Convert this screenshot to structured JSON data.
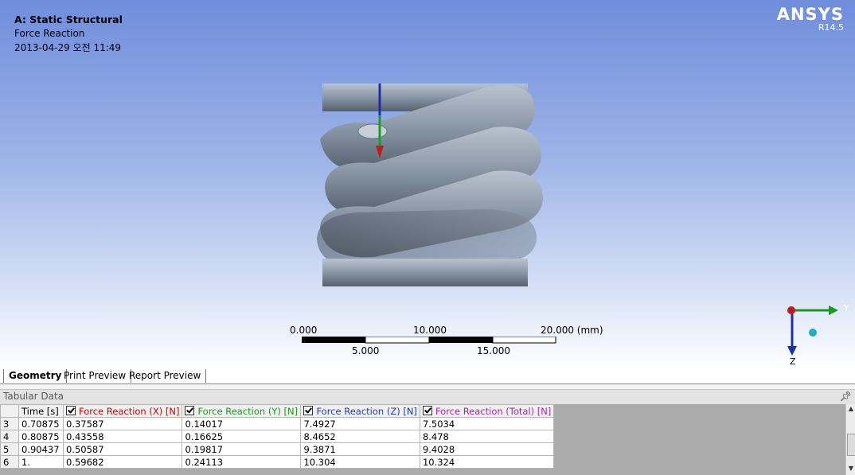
{
  "viewport": {
    "title": "A: Static Structural",
    "subtitle": "Force Reaction",
    "timestamp": "2013-04-29 오전 11:49",
    "logo": {
      "brand": "ANSYS",
      "version": "R14.5"
    },
    "scale": {
      "top_labels": [
        "0.000",
        "10.000",
        "20.000 (mm)"
      ],
      "bottom_labels": [
        "5.000",
        "15.000"
      ]
    },
    "triad": {
      "y_label": "Y",
      "z_label": "Z"
    }
  },
  "tabs": [
    {
      "label": "Geometry",
      "active": true
    },
    {
      "label": "Print Preview",
      "active": false
    },
    {
      "label": "Report Preview",
      "active": false
    }
  ],
  "tabular": {
    "title": "Tabular Data",
    "pin_icon": "pin-icon",
    "columns": [
      {
        "label": "Time [s]",
        "checkbox": false,
        "color": "#000000"
      },
      {
        "label": "Force Reaction (X) [N]",
        "checkbox": true,
        "color": "#cc0000"
      },
      {
        "label": "Force Reaction (Y) [N]",
        "checkbox": true,
        "color": "#1a9a1a"
      },
      {
        "label": "Force Reaction (Z) [N]",
        "checkbox": true,
        "color": "#1a3fbf"
      },
      {
        "label": "Force Reaction (Total) [N]",
        "checkbox": true,
        "color": "#b020b0"
      }
    ],
    "rows": [
      {
        "n": "3",
        "cells": [
          "0.70875",
          "0.37587",
          "0.14017",
          "7.4927",
          "7.5034"
        ]
      },
      {
        "n": "4",
        "cells": [
          "0.80875",
          "0.43558",
          "0.16625",
          "8.4652",
          "8.478"
        ]
      },
      {
        "n": "5",
        "cells": [
          "0.90437",
          "0.50587",
          "0.19817",
          "9.3871",
          "9.4028"
        ]
      },
      {
        "n": "6",
        "cells": [
          "1.",
          "0.59682",
          "0.24113",
          "10.304",
          "10.324"
        ]
      }
    ]
  },
  "colors": {
    "viewport_top": "#6f8ddc",
    "viewport_bottom": "#ffffff",
    "model": "#8e9aa8"
  }
}
